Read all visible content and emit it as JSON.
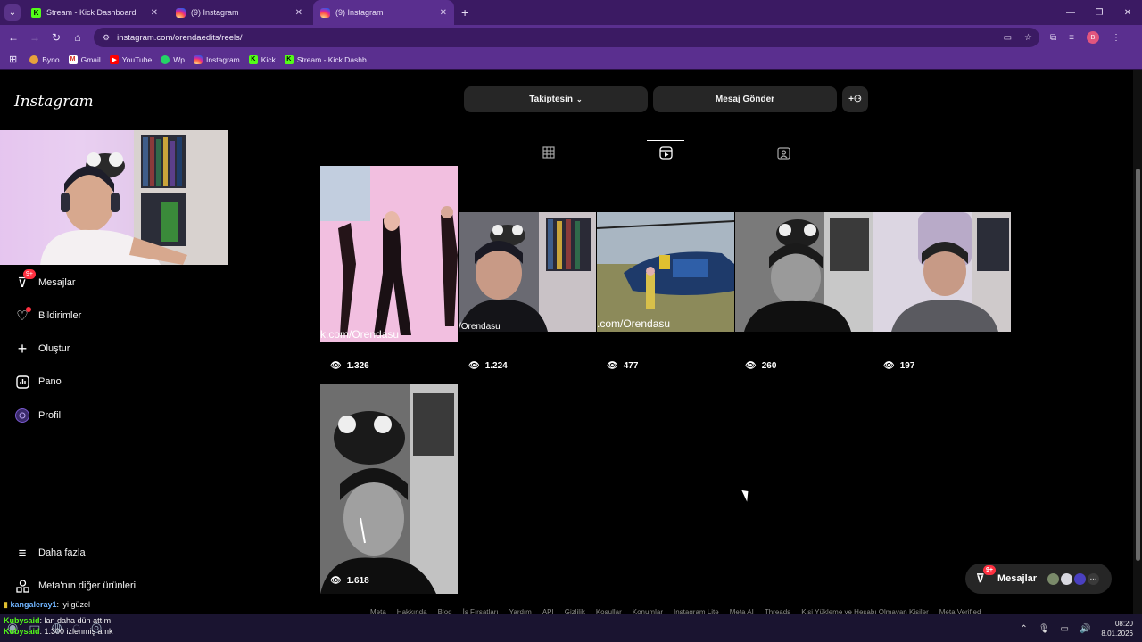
{
  "browser": {
    "tabs": [
      {
        "title": "Stream - Kick Dashboard",
        "favicon": "kick-icon"
      },
      {
        "title": "(9) Instagram",
        "favicon": "instagram-icon"
      },
      {
        "title": "(9) Instagram",
        "favicon": "instagram-icon",
        "active": true
      }
    ],
    "url": "instagram.com/orendaedits/reels/",
    "profile_initial": "B",
    "bookmarks": [
      "Byno",
      "Gmail",
      "YouTube",
      "Wp",
      "Instagram",
      "Kick",
      "Stream - Kick Dashb..."
    ]
  },
  "instagram": {
    "logo": "Instagram",
    "sidebar": {
      "messages": {
        "label": "Mesajlar",
        "badge": "9+"
      },
      "notifications": {
        "label": "Bildirimler"
      },
      "create": {
        "label": "Oluştur"
      },
      "dashboard": {
        "label": "Pano"
      },
      "profile": {
        "label": "Profil"
      },
      "more": {
        "label": "Daha fazla"
      },
      "meta": {
        "label": "Meta'nın diğer ürünleri"
      }
    },
    "profile_actions": {
      "following": "Takiptesin",
      "message": "Mesaj Gönder"
    },
    "reels": [
      {
        "views": "1.326",
        "watermark": "k.com/Orendasu"
      },
      {
        "views": "1.224",
        "watermark": "/Orendasu"
      },
      {
        "views": "477",
        "watermark": ".com/Orendasu"
      },
      {
        "views": "260",
        "watermark": ""
      },
      {
        "views": "197",
        "watermark": ""
      },
      {
        "views": "1.618",
        "watermark": ""
      }
    ],
    "footer": [
      "Meta",
      "Hakkında",
      "Blog",
      "İş Fırsatları",
      "Yardım",
      "API",
      "Gizlilik",
      "Koşullar",
      "Konumlar",
      "Instagram Lite",
      "Meta AI",
      "Threads",
      "Kişi Yükleme ve Hesabı Olmayan Kişiler",
      "Meta Verified"
    ],
    "messages_pill": {
      "label": "Mesajlar",
      "badge": "9+"
    }
  },
  "chat": [
    {
      "user": "kangaleray1",
      "text": ": iyi güzel"
    },
    {
      "user": "Kubysaid",
      "text": ": lan daha dün attım"
    },
    {
      "user": "Kubysaid",
      "text": ": 1.300 izlenmiş amk"
    }
  ],
  "taskbar": {
    "time": "08:20",
    "date": "8.01.2026"
  }
}
